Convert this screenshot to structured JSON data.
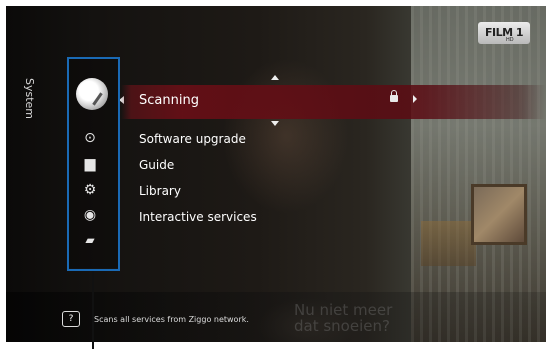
{
  "header": {
    "section_label": "System"
  },
  "logo": {
    "text": "FILM 1",
    "sub": "HD"
  },
  "sidebar": {
    "icons": [
      {
        "name": "satellite-dish-icon"
      },
      {
        "name": "disc-icon"
      },
      {
        "name": "monitor-icon"
      },
      {
        "name": "gear-icon"
      },
      {
        "name": "globe-icon"
      },
      {
        "name": "card-icon"
      }
    ]
  },
  "menu": {
    "items": [
      {
        "label": "Scanning",
        "active": true,
        "locked": true
      },
      {
        "label": "Software upgrade"
      },
      {
        "label": "Guide"
      },
      {
        "label": "Library"
      },
      {
        "label": "Interactive services"
      }
    ]
  },
  "help": {
    "icon": "?",
    "text": "Scans all services from Ziggo network.",
    "background_text_1": "Nu niet meer",
    "background_text_2": "dat snoeien?"
  },
  "colors": {
    "highlight": "#7a0e18",
    "annotation": "#1a6ab5"
  }
}
